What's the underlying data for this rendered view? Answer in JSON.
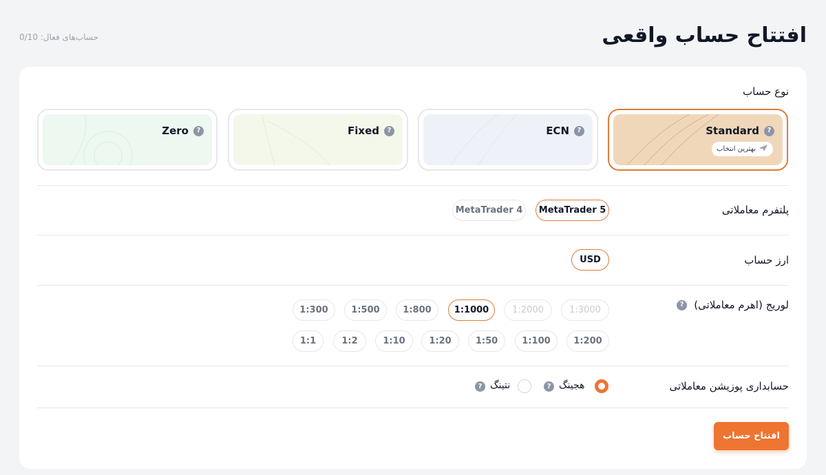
{
  "header": {
    "title": "افتتاح حساب واقعی",
    "active_accounts": "حساب‌های فعال: 0/10"
  },
  "account_type": {
    "label": "نوع حساب",
    "options": [
      {
        "name": "Standard",
        "badge": "بهترین انتخاب",
        "selected": true,
        "color": "#f0d7ba"
      },
      {
        "name": "ECN",
        "selected": false,
        "color": "#eef2f8"
      },
      {
        "name": "Fixed",
        "selected": false,
        "color": "#f4f8ea"
      },
      {
        "name": "Zero",
        "selected": false,
        "color": "#ecf8f0"
      }
    ]
  },
  "platform": {
    "label": "پلتفرم معاملاتی",
    "options": [
      "MetaTrader 5",
      "MetaTrader 4"
    ],
    "selected": "MetaTrader 5"
  },
  "currency": {
    "label": "ارز حساب",
    "options": [
      "USD"
    ],
    "selected": "USD"
  },
  "leverage": {
    "label": "لوریج (اهرم معاملاتی)",
    "row1": [
      "1:3000",
      "1:2000",
      "1:1000",
      "1:800",
      "1:500",
      "1:300"
    ],
    "row2": [
      "1:200",
      "1:100",
      "1:50",
      "1:20",
      "1:10",
      "1:2",
      "1:1"
    ],
    "selected": "1:1000",
    "disabled": [
      "1:3000",
      "1:2000"
    ]
  },
  "position_accounting": {
    "label": "حسابداری پوزیشن معاملاتی",
    "options": [
      "هجینگ",
      "نتینگ"
    ],
    "selected": "هجینگ"
  },
  "submit_label": "افتتاح حساب",
  "icons": {
    "help": "question-circle-icon",
    "badge": "rocket-icon"
  },
  "colors": {
    "accent": "#ee7431",
    "border_active": "#e07b39"
  }
}
